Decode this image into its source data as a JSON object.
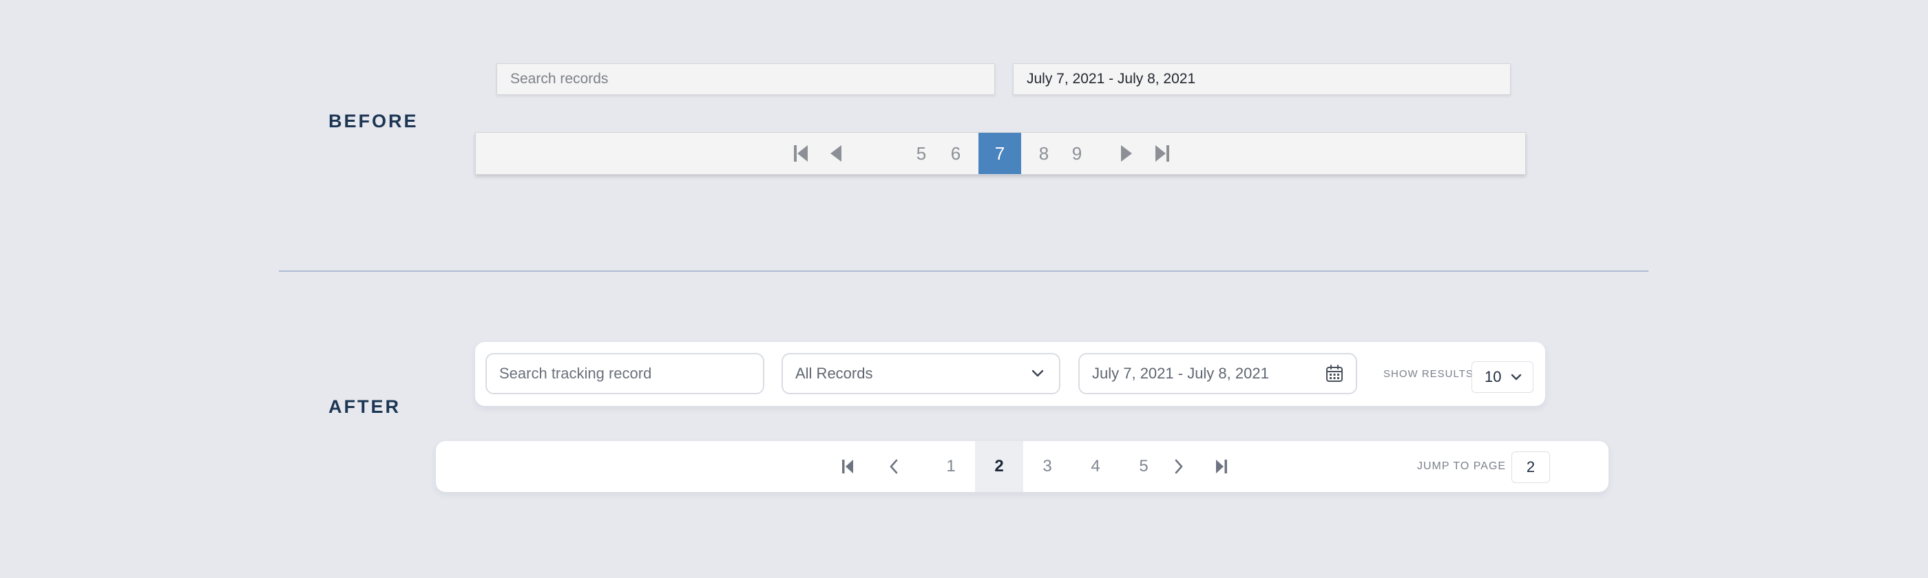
{
  "sections": {
    "before_label": "BEFORE",
    "after_label": "AFTER"
  },
  "before": {
    "search_placeholder": "Search records",
    "date_value": "July 7, 2021 - July 8, 2021",
    "pagination": {
      "pages": [
        "5",
        "6",
        "7",
        "8",
        "9"
      ],
      "current": "7",
      "icons": [
        "first-page-icon",
        "prev-page-icon",
        "next-page-icon",
        "last-page-icon"
      ],
      "active_color": "#4a84bf"
    }
  },
  "after": {
    "search_placeholder": "Search tracking record",
    "record_filter": {
      "value": "All Records",
      "icon": "chevron-down-icon"
    },
    "date_range": {
      "value": "July 7, 2021 - July 8, 2021",
      "icon": "calendar-icon"
    },
    "show_results": {
      "label": "SHOW RESULTS",
      "value": "10"
    },
    "pagination": {
      "pages": [
        "1",
        "2",
        "3",
        "4",
        "5"
      ],
      "current": "2",
      "icons": [
        "first-page-icon",
        "prev-page-icon",
        "next-page-icon",
        "last-page-icon"
      ]
    },
    "jump": {
      "label": "JUMP TO PAGE",
      "value": "2"
    }
  },
  "colors": {
    "background": "#e6e8ee",
    "heading": "#1c3552",
    "divider": "#aebbd3"
  }
}
